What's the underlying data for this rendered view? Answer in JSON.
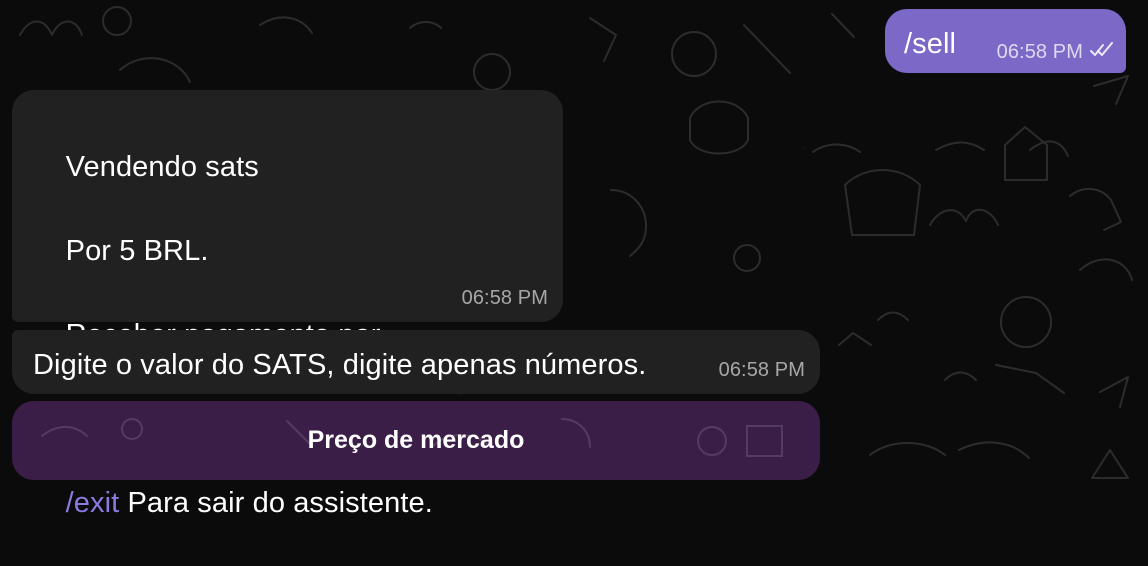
{
  "chat": {
    "outgoing": {
      "text": "/sell",
      "time": "06:58 PM",
      "status_icon": "double-check-icon"
    },
    "incoming": [
      {
        "lines": [
          "Vendendo sats",
          "Por 5 BRL.",
          "Receber pagamento por __",
          ""
        ],
        "command": "/exit",
        "command_text": " Para sair do assistente.",
        "time": "06:58 PM"
      },
      {
        "text": "Digite o valor do SATS, digite apenas números.",
        "time": "06:58 PM"
      }
    ],
    "keyboard": {
      "button_label": "Preço de mercado"
    }
  },
  "colors": {
    "background": "#0b0b0c",
    "outgoing_bubble": "#7b68c7",
    "incoming_bubble": "#212121",
    "command_accent": "#8b7ae0",
    "keyboard_button": "#4b255c"
  }
}
